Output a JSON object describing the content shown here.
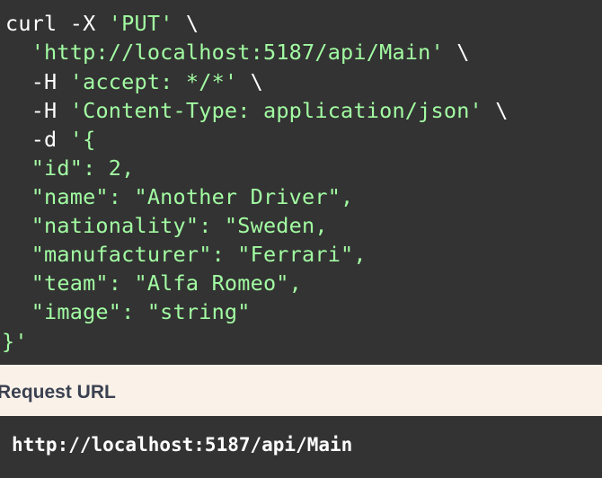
{
  "curl": {
    "lines": [
      [
        {
          "t": "curl -X ",
          "c": "white"
        },
        {
          "t": "'PUT'",
          "c": "green"
        },
        {
          "t": " \\",
          "c": "white"
        }
      ],
      [
        {
          "t": "  ",
          "c": "white"
        },
        {
          "t": "'http://localhost:5187/api/Main'",
          "c": "green"
        },
        {
          "t": " \\",
          "c": "white"
        }
      ],
      [
        {
          "t": "  -H ",
          "c": "white"
        },
        {
          "t": "'accept: */*'",
          "c": "green"
        },
        {
          "t": " \\",
          "c": "white"
        }
      ],
      [
        {
          "t": "  -H ",
          "c": "white"
        },
        {
          "t": "'Content-Type: application/json'",
          "c": "green"
        },
        {
          "t": " \\",
          "c": "white"
        }
      ],
      [
        {
          "t": "  -d ",
          "c": "white"
        },
        {
          "t": "'{",
          "c": "green"
        }
      ],
      [
        {
          "t": "  \"id\": 2,",
          "c": "green"
        }
      ],
      [
        {
          "t": "  \"name\": \"Another Driver\",",
          "c": "green"
        }
      ],
      [
        {
          "t": "  \"nationality\": \"Sweden,",
          "c": "green"
        }
      ],
      [
        {
          "t": "  \"manufacturer\": \"Ferrari\",",
          "c": "green"
        }
      ],
      [
        {
          "t": "  \"team\": \"Alfa Romeo\",",
          "c": "green"
        }
      ],
      [
        {
          "t": "  \"image\": \"string\"",
          "c": "green"
        }
      ],
      [
        {
          "t": "}'",
          "c": "green"
        }
      ]
    ]
  },
  "request_url": {
    "title": "Request URL",
    "url": "http://localhost:5187/api/Main"
  },
  "colors": {
    "code_background": "#333333",
    "string_green": "#a2fca2",
    "text_white": "#ffffff",
    "section_background": "#faf2e9",
    "section_title": "#3b4151"
  }
}
